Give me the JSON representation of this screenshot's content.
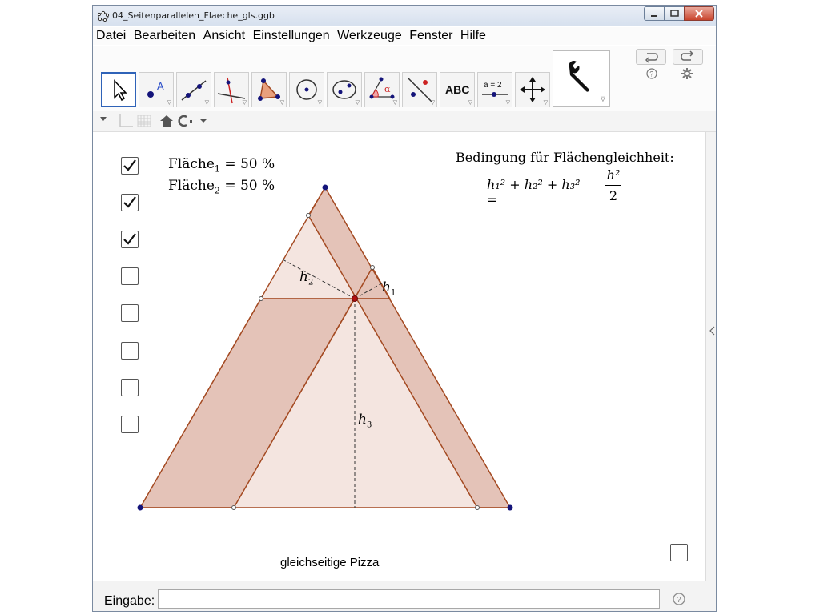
{
  "window": {
    "title": "04_Seitenparallelen_Flaeche_gls.ggb"
  },
  "menu": {
    "items": [
      "Datei",
      "Bearbeiten",
      "Ansicht",
      "Einstellungen",
      "Werkzeuge",
      "Fenster",
      "Hilfe"
    ]
  },
  "toolbar": {
    "tools": [
      {
        "name": "move-tool",
        "label": ""
      },
      {
        "name": "point-tool",
        "label": "A"
      },
      {
        "name": "line-tool",
        "label": ""
      },
      {
        "name": "perpendicular-tool",
        "label": ""
      },
      {
        "name": "polygon-tool",
        "label": ""
      },
      {
        "name": "circle-tool",
        "label": ""
      },
      {
        "name": "conic-tool",
        "label": ""
      },
      {
        "name": "angle-tool",
        "label": "α"
      },
      {
        "name": "reflect-tool",
        "label": ""
      },
      {
        "name": "text-tool",
        "label": "ABC"
      },
      {
        "name": "slider-tool",
        "label": "a = 2"
      },
      {
        "name": "move-view-tool",
        "label": ""
      }
    ],
    "big_tool": "wrench-icon"
  },
  "graphics": {
    "flaeche1_label": "Fläche",
    "flaeche1_sub": "1",
    "flaeche1_value": "= 50 %",
    "flaeche2_label": "Fläche",
    "flaeche2_sub": "2",
    "flaeche2_value": "= 50 %",
    "bedingung_title": "Bedingung für Flächengleichheit:",
    "formula_lhs": "h₁² + h₂² + h₃² =",
    "formula_num": "h²",
    "formula_den": "2",
    "h1_label": "h",
    "h1_sub": "1",
    "h2_label": "h",
    "h2_sub": "2",
    "h3_label": "h",
    "h3_sub": "3",
    "caption": "gleichseitige Pizza",
    "checkboxes": [
      true,
      true,
      true,
      false,
      false,
      false,
      false,
      false
    ],
    "checkbox_bottom_right": false
  },
  "inputbar": {
    "label": "Eingabe:",
    "value": ""
  },
  "colors": {
    "fill_dark": "#e4c3b8",
    "fill_light": "#f4e5e0",
    "stroke": "#a44a22",
    "vertex": "#14147a"
  }
}
